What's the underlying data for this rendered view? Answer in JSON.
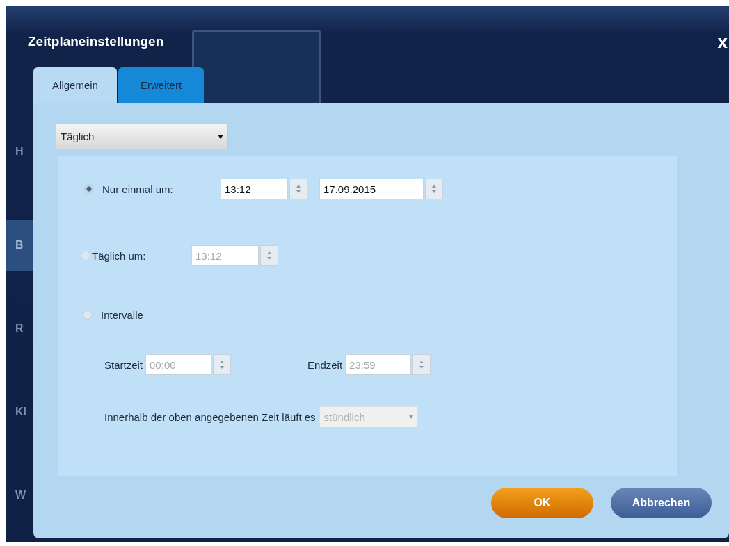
{
  "window": {
    "title": "Zeitplaneinstellungen",
    "close": "x"
  },
  "background_sidebar": [
    {
      "label": "H",
      "selected": false
    },
    {
      "label": "B",
      "selected": true
    },
    {
      "label": "R",
      "selected": false
    },
    {
      "label": "Kl",
      "selected": false
    },
    {
      "label": "W",
      "selected": false
    }
  ],
  "tabs": [
    {
      "label": "Allgemein",
      "selected": true
    },
    {
      "label": "Erweitert",
      "selected": false
    }
  ],
  "schedule_type": {
    "value": "Täglich"
  },
  "options": [
    {
      "kind": "once",
      "label": "Nur einmal um:",
      "selected": true,
      "fields": [
        {
          "value": "13:12",
          "disabled": false
        },
        {
          "value": "17.09.2015",
          "disabled": false
        }
      ]
    },
    {
      "kind": "daily",
      "label": "Täglich um:",
      "selected": false,
      "fields": [
        {
          "value": "13:12",
          "disabled": true
        }
      ]
    },
    {
      "kind": "interval",
      "label": "Intervalle",
      "selected": false
    }
  ],
  "interval": {
    "start_label": "Startzeit",
    "start": {
      "value": "00:00",
      "disabled": true
    },
    "end_label": "Endzeit",
    "end": {
      "value": "23:59",
      "disabled": true
    },
    "repeat_label": "Innerhalb der oben angegebenen Zeit läuft es",
    "repeat": {
      "value": "stündlich",
      "disabled": true
    }
  },
  "buttons": [
    {
      "kind": "primary",
      "label": "OK"
    },
    {
      "kind": "secondary",
      "label": "Abbrechen"
    }
  ]
}
